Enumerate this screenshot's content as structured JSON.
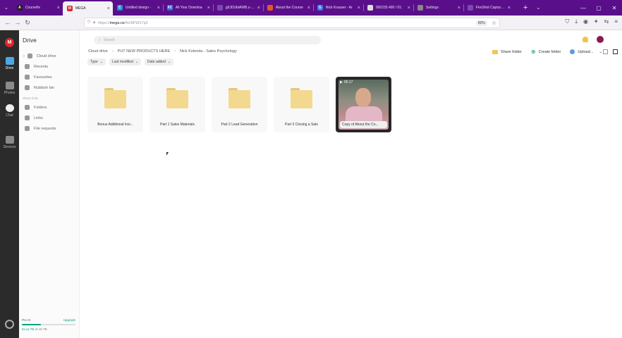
{
  "browser": {
    "tabs": [
      {
        "label": "Coursefix",
        "color": "#222222",
        "glyph": "A",
        "active": false
      },
      {
        "label": "MEGA",
        "color": "#d9272e",
        "glyph": "M",
        "active": true
      },
      {
        "label": "Untitled design -",
        "color": "#1f8fd6",
        "glyph": "C",
        "active": false
      },
      {
        "label": "All Your Downloa",
        "color": "#2a6ad9",
        "glyph": "XC",
        "active": false
      },
      {
        "label": "g9JDUbiAWB.z-9-y-s",
        "color": "#7a4ab0",
        "glyph": "",
        "active": false
      },
      {
        "label": "About the Course",
        "color": "#e35a2a",
        "glyph": "",
        "active": false
      },
      {
        "label": "Nick Krauser - Ar",
        "color": "#3b7cea",
        "glyph": "G",
        "active": false
      },
      {
        "label": "000235.490 / 01:",
        "color": "#dddddd",
        "glyph": "",
        "active": false
      },
      {
        "label": "Settings",
        "color": "#888888",
        "glyph": "",
        "active": false
      },
      {
        "label": "FireShot Capture 046",
        "color": "#7a4ab0",
        "glyph": "",
        "active": false
      }
    ],
    "new_tab": "+",
    "url_prefix": "https://",
    "url_domain": "mega.nz",
    "url_rest": "/fm/9FW17p2",
    "zoom": "80%"
  },
  "rail": {
    "logo": "M",
    "items": [
      {
        "label": "Drive",
        "icon": "drive-icon",
        "color": "#4aa8e8"
      },
      {
        "label": "Photos",
        "icon": "photos-icon",
        "color": "#8a8a8a"
      },
      {
        "label": "Chat",
        "icon": "chat-icon",
        "color": "#eeeeee"
      },
      {
        "label": "Devices",
        "icon": "devices-icon",
        "color": "#8a8a8a"
      }
    ]
  },
  "sidebar": {
    "title": "Drive",
    "items": [
      {
        "label": "Cloud drive",
        "icon": "cloud-icon"
      },
      {
        "label": "Recents",
        "icon": "clock-icon"
      },
      {
        "label": "Favourites",
        "icon": "heart-icon"
      },
      {
        "label": "Rubbish bin",
        "icon": "trash-icon"
      }
    ],
    "share_label": "Share links",
    "share_items": [
      {
        "label": "Folders",
        "icon": "folder-link-icon"
      },
      {
        "label": "Links",
        "icon": "link-icon"
      },
      {
        "label": "File requests",
        "icon": "file-request-icon"
      }
    ],
    "storage": {
      "plan": "Pro III",
      "upgrade": "Upgrade",
      "used": "5x.xx TB",
      "total": "of 16 TB",
      "fraction": 0.35
    }
  },
  "main": {
    "search_placeholder": "Search",
    "breadcrumbs": [
      "Cloud drive",
      "PUT NEW PRODUCTS HERE",
      "Nick Kolenda - Sales Psychology"
    ],
    "crumb_sep": "›",
    "actions": {
      "share": "Share folder",
      "create": "Create folder",
      "upload": "Upload..."
    },
    "filters": [
      {
        "label": "Type"
      },
      {
        "label": "Last modified"
      },
      {
        "label": "Date added"
      }
    ],
    "filter_chevron": "⌄",
    "items": [
      {
        "type": "folder",
        "name": "Bonus Additional Insi..."
      },
      {
        "type": "folder",
        "name": "Part 1 Sales Materials"
      },
      {
        "type": "folder",
        "name": "Part 2 Lead Generation"
      },
      {
        "type": "folder",
        "name": "Part 3 Closing a Sale"
      },
      {
        "type": "video",
        "name": "Copy of About the Co...",
        "duration": "05:17"
      }
    ]
  }
}
